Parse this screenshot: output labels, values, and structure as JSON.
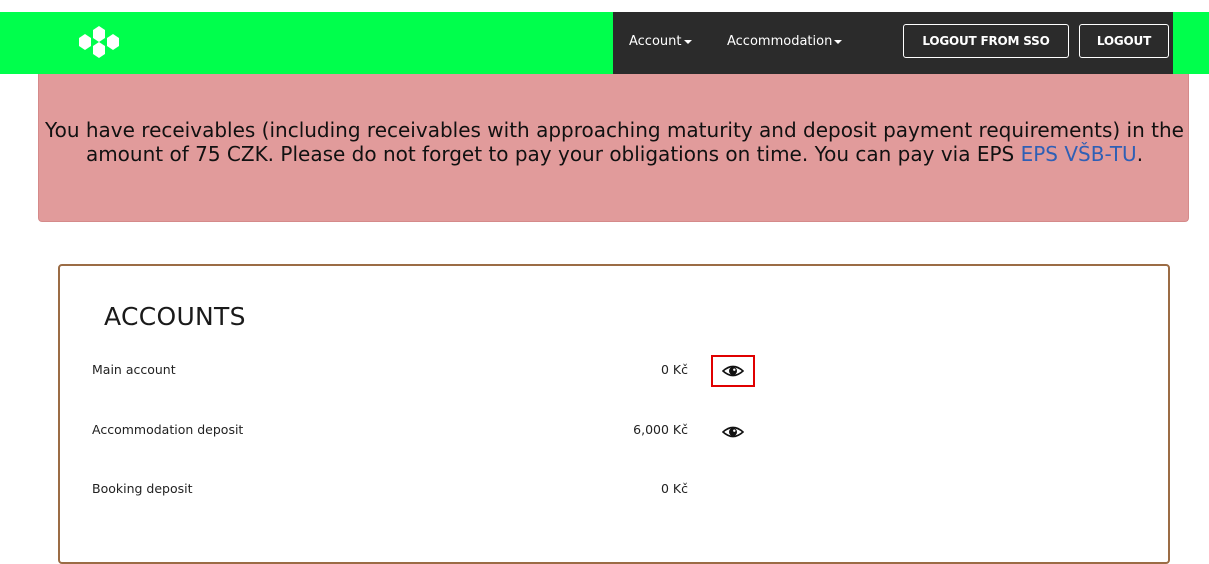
{
  "navbar": {
    "logo_icon": "hexagon-cluster-logo",
    "brand_color": "#00ff4c",
    "account_label": "Account",
    "accommodation_label": "Accommodation",
    "logout_sso_label": "LOGOUT FROM SSO",
    "logout_label": "LOGOUT"
  },
  "alert": {
    "text": "You have receivables (including receivables with approaching maturity and deposit payment requirements) in the amount of 75 CZK. Please do not forget to pay your obligations on time. You can pay via EPS ",
    "link_text": "EPS VŠB-TU",
    "text_end": ".",
    "background_color": "#e19b9b"
  },
  "accounts": {
    "title": "ACCOUNTS",
    "rows": [
      {
        "label": "Main account",
        "value": "0 Kč",
        "icon": "eye-icon"
      },
      {
        "label": "Accommodation deposit",
        "value": "6,000 Kč",
        "icon": "eye-icon"
      },
      {
        "label": "Booking deposit",
        "value": "0 Kč"
      }
    ]
  }
}
